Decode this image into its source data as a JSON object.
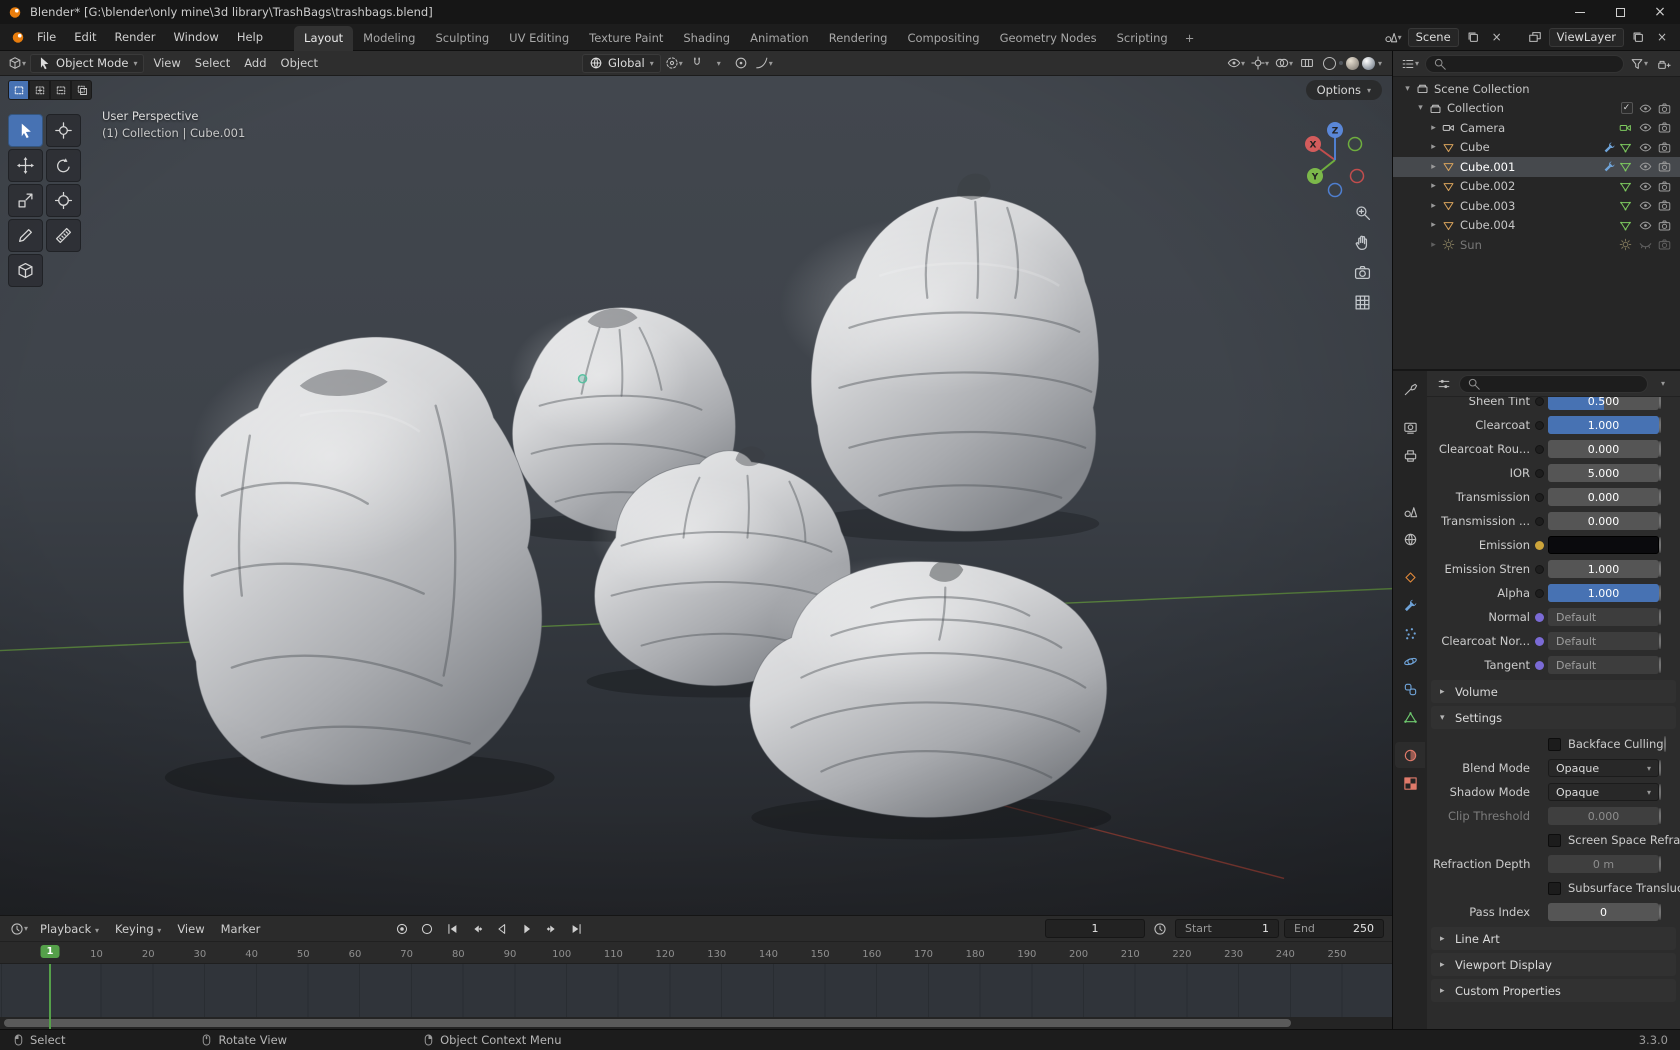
{
  "app": {
    "title": "Blender* [G:\\blender\\only mine\\3d library\\TrashBags\\trashbags.blend]",
    "version": "3.3.0"
  },
  "colors": {
    "accent_blue": "#4772b3",
    "playhead_green": "#55a04a",
    "object_orange": "#e0883a"
  },
  "menubar": {
    "menus": [
      "File",
      "Edit",
      "Render",
      "Window",
      "Help"
    ],
    "tabs": [
      "Layout",
      "Modeling",
      "Sculpting",
      "UV Editing",
      "Texture Paint",
      "Shading",
      "Animation",
      "Rendering",
      "Compositing",
      "Geometry Nodes",
      "Scripting"
    ],
    "active_tab": "Layout",
    "add_tab": "+",
    "scene_field": "Scene",
    "viewlayer_field": "ViewLayer"
  },
  "viewport": {
    "mode": "Object Mode",
    "menus": [
      "View",
      "Select",
      "Add",
      "Object"
    ],
    "orientation": "Global",
    "options_button": "Options",
    "overlay_line1": "User Perspective",
    "overlay_line2": "(1) Collection | Cube.001",
    "axis_labels": {
      "x": "X",
      "y": "Y",
      "z": "Z"
    },
    "select_modes": [
      "set",
      "extend",
      "subtract",
      "intersect"
    ],
    "tools": [
      "select-box",
      "cursor",
      "move",
      "rotate",
      "scale",
      "transform",
      "annotate",
      "measure",
      "add-cube"
    ],
    "nav_icons": [
      "zoom",
      "pan-hand",
      "toggle-camera",
      "toggle-projection"
    ],
    "header_icons": [
      "visibility",
      "gizmos",
      "overlays",
      "xray",
      "shading-wireframe",
      "shading-solid",
      "shading-material",
      "shading-rendered"
    ],
    "active_shading": "shading-solid"
  },
  "outliner": {
    "title": "Scene Collection",
    "items": [
      {
        "name": "Collection",
        "icon": "collection",
        "level": 1,
        "disclosure": "open",
        "checkbox": true,
        "badges": []
      },
      {
        "name": "Camera",
        "icon": "camera-obj",
        "level": 2,
        "disclosure": "closed",
        "badges": [
          "camera-data"
        ]
      },
      {
        "name": "Cube",
        "icon": "mesh-obj",
        "level": 2,
        "disclosure": "closed",
        "badges": [
          "wrench",
          "mesh-data"
        ]
      },
      {
        "name": "Cube.001",
        "icon": "mesh-obj",
        "level": 2,
        "disclosure": "closed",
        "active": true,
        "badges": [
          "wrench",
          "mesh-data"
        ]
      },
      {
        "name": "Cube.002",
        "icon": "mesh-obj",
        "level": 2,
        "disclosure": "closed",
        "badges": [
          "mesh-data"
        ]
      },
      {
        "name": "Cube.003",
        "icon": "mesh-obj",
        "level": 2,
        "disclosure": "closed",
        "badges": [
          "mesh-data"
        ]
      },
      {
        "name": "Cube.004",
        "icon": "mesh-obj",
        "level": 2,
        "disclosure": "closed",
        "badges": [
          "mesh-data"
        ]
      },
      {
        "name": "Sun",
        "icon": "sun",
        "level": 2,
        "disclosure": "closed",
        "dim": true,
        "hidden": true,
        "badges": [
          "sun-data"
        ]
      }
    ]
  },
  "properties": {
    "tabs": [
      "tool",
      "render",
      "output",
      "view-layer",
      "scene",
      "world",
      "object",
      "modifiers",
      "particles",
      "physics",
      "constraints",
      "data",
      "material",
      "texture"
    ],
    "active_tab": "material",
    "surface_rows": [
      {
        "label": "Sheen Tint",
        "widget": "slider",
        "value": "0.500",
        "fill": 0.5,
        "clipped": true
      },
      {
        "label": "Clearcoat",
        "widget": "slider",
        "value": "1.000",
        "fill": 1
      },
      {
        "label": "Clearcoat Rou...",
        "widget": "slider",
        "value": "0.000",
        "fill": 0
      },
      {
        "label": "IOR",
        "widget": "slider",
        "value": "5.000",
        "fill": 0
      },
      {
        "label": "Transmission",
        "widget": "slider",
        "value": "0.000",
        "fill": 0
      },
      {
        "label": "Transmission ...",
        "widget": "slider",
        "value": "0.000",
        "fill": 0
      },
      {
        "label": "Emission",
        "widget": "color",
        "socket": "#cda53b"
      },
      {
        "label": "Emission Stren",
        "widget": "slider",
        "value": "1.000",
        "fill": 0
      },
      {
        "label": "Alpha",
        "widget": "slider",
        "value": "1.000",
        "fill": 1
      },
      {
        "label": "Normal",
        "widget": "vector",
        "value": "Default",
        "socket": "#7b6bd6"
      },
      {
        "label": "Clearcoat Nor...",
        "widget": "vector",
        "value": "Default",
        "socket": "#7b6bd6"
      },
      {
        "label": "Tangent",
        "widget": "vector",
        "value": "Default",
        "socket": "#7b6bd6"
      }
    ],
    "sections_before": [
      {
        "label": "Volume",
        "expanded": false
      }
    ],
    "settings": {
      "label": "Settings",
      "rows": [
        {
          "type": "check",
          "label": "Backface Culling",
          "checked": false
        },
        {
          "type": "menu",
          "label": "Blend Mode",
          "value": "Opaque"
        },
        {
          "type": "menu",
          "label": "Shadow Mode",
          "value": "Opaque"
        },
        {
          "type": "field",
          "label": "Clip Threshold",
          "value": "0.000",
          "disabled": true
        },
        {
          "type": "check",
          "label": "Screen Space Refract...",
          "checked": false
        },
        {
          "type": "field",
          "label": "Refraction Depth",
          "value": "0 m",
          "disabled": "field"
        },
        {
          "type": "check",
          "label": "Subsurface Transluce...",
          "checked": false
        },
        {
          "type": "field",
          "label": "Pass Index",
          "value": "0"
        }
      ]
    },
    "sections_after": [
      {
        "label": "Line Art"
      },
      {
        "label": "Viewport Display"
      },
      {
        "label": "Custom Properties"
      }
    ]
  },
  "timeline": {
    "menus": [
      {
        "label": "Playback",
        "caret": true
      },
      {
        "label": "Keying",
        "caret": true
      },
      {
        "label": "View",
        "caret": false
      },
      {
        "label": "Marker",
        "caret": false
      }
    ],
    "transport": [
      "auto-key",
      "keying-set",
      "jump-start",
      "prev-keyframe",
      "play-reverse",
      "play",
      "next-keyframe",
      "jump-end"
    ],
    "current_frame": "1",
    "playhead_frame": 1,
    "start_label": "Start",
    "start_value": "1",
    "end_label": "End",
    "end_value": "250",
    "ticks": [
      10,
      20,
      30,
      40,
      50,
      60,
      70,
      80,
      90,
      100,
      110,
      120,
      130,
      140,
      150,
      160,
      170,
      180,
      190,
      200,
      210,
      220,
      230,
      240,
      250
    ]
  },
  "statusbar": {
    "items": [
      {
        "icon": "mouse-left",
        "label": "Select"
      },
      {
        "icon": "mouse-middle",
        "label": "Rotate View"
      },
      {
        "icon": "mouse-right",
        "label": "Object Context Menu"
      }
    ]
  }
}
